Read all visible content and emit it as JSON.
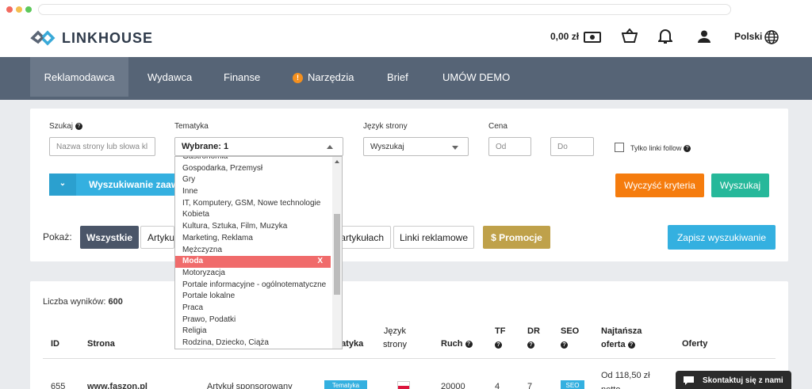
{
  "header": {
    "logo_text": "LINKHOUSE",
    "balance": "0,00 zł",
    "language": "Polski"
  },
  "nav": {
    "items": [
      "Reklamodawca",
      "Wydawca",
      "Finanse",
      "Narzędzia",
      "Brief",
      "UMÓW DEMO"
    ]
  },
  "filters": {
    "search_label": "Szukaj",
    "search_placeholder": "Nazwa strony lub słowa kl",
    "topic_label": "Tematyka",
    "topic_value": "Wybrane: 1",
    "lang_label": "Język strony",
    "lang_value": "Wyszukaj",
    "price_label": "Cena",
    "price_from_placeholder": "Od",
    "price_to_placeholder": "Do",
    "follow_label": "Tylko linki follow",
    "advanced_label": "Wyszukiwanie zaawa",
    "clear_label": "Wyczyść kryteria",
    "search_button": "Wyszukaj",
    "show_label": "Pokaż:",
    "tab_all": "Wszystkie",
    "tab_articles": "Artykuł",
    "tab_in_articles": "artykułach",
    "tab_links": "Linki reklamowe",
    "promo_label": "$ Promocje",
    "save_search": "Zapisz wyszukiwanie"
  },
  "dropdown": {
    "items": [
      "Gastronomia",
      "Gospodarka, Przemysł",
      "Gry",
      "Inne",
      "IT, Komputery, GSM, Nowe technologie",
      "Kobieta",
      "Kultura, Sztuka, Film, Muzyka",
      "Marketing, Reklama",
      "Mężczyzna",
      "Moda",
      "Motoryzacja",
      "Portale informacyjne - ogólnotematyczne",
      "Portale lokalne",
      "Praca",
      "Prawo, Podatki",
      "Religia",
      "Rodzina, Dziecko, Ciąża"
    ],
    "selected": "Moda",
    "remove_label": "X"
  },
  "results": {
    "count_label": "Liczba wyników:",
    "count": "600",
    "columns": {
      "id": "ID",
      "site": "Strona",
      "topic": "atyka",
      "lang_line1": "Język",
      "lang_line2": "strony",
      "traffic": "Ruch",
      "tf": "TF",
      "dr": "DR",
      "seo": "SEO",
      "cheapest_line1": "Najtańsza",
      "cheapest_line2": "oferta",
      "offers": "Oferty"
    },
    "row": {
      "id": "655",
      "site": "www.faszon.pl",
      "type": "Artykuł sponsorowany",
      "topic_badge": "Tematyka",
      "traffic": "20000",
      "tf": "4",
      "dr": "7",
      "seo_badge": "SEO",
      "price_line1": "Od 118,50 zł",
      "price_line2": "netto"
    }
  },
  "contact": {
    "label": "Skontaktuj się z nami"
  },
  "colors": {
    "nav_bg": "#566476",
    "accent_blue": "#34b0e0",
    "orange": "#f57c0e",
    "teal": "#26b89a",
    "gold": "#bfa14a",
    "selected_red": "#f06b6b"
  }
}
